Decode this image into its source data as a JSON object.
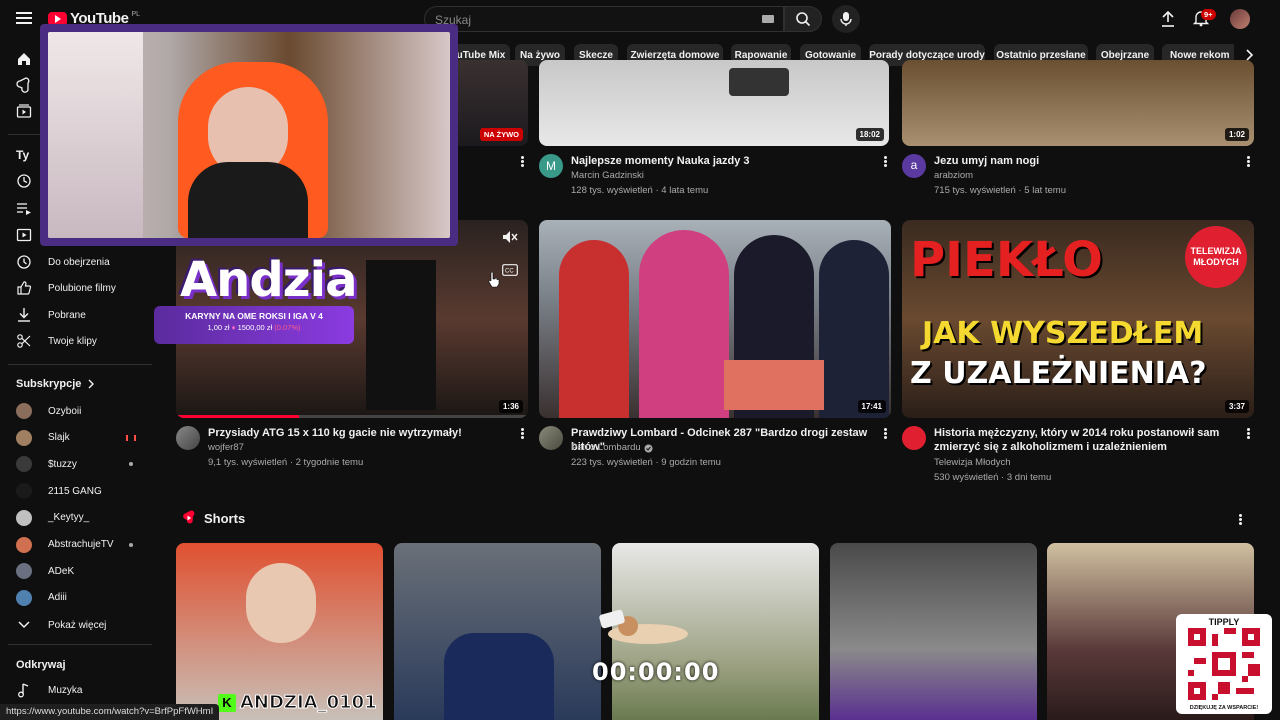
{
  "header": {
    "logo_text": "YouTube",
    "country_code": "PL",
    "search_placeholder": "Szukaj",
    "notification_count": "9+"
  },
  "sidebar": {
    "main_items": [
      {
        "icon": "home-icon"
      },
      {
        "icon": "shorts-icon"
      },
      {
        "icon": "subscriptions-icon"
      }
    ],
    "you_heading": "Ty",
    "you_items": [
      {
        "icon": "history-icon",
        "label": ""
      },
      {
        "icon": "playlists-icon",
        "label": ""
      },
      {
        "icon": "your-videos-icon",
        "label": ""
      },
      {
        "icon": "watch-later-icon",
        "label": "Do obejrzenia"
      },
      {
        "icon": "like-icon",
        "label": "Polubione filmy"
      },
      {
        "icon": "download-icon",
        "label": "Pobrane"
      },
      {
        "icon": "scissors-icon",
        "label": "Twoje klipy"
      }
    ],
    "subs_heading": "Subskrypcje",
    "channels": [
      {
        "name": "Ozyboii",
        "color": "#8a6d5a",
        "live": false,
        "dot": false
      },
      {
        "name": "Slajk",
        "color": "#a08060",
        "live": true,
        "dot": false
      },
      {
        "name": "$tuzzy",
        "color": "#3a3a3a",
        "live": false,
        "dot": true
      },
      {
        "name": "2115 GANG",
        "color": "#1a1a1a",
        "live": false,
        "dot": false
      },
      {
        "name": "_Keytyy_",
        "color": "#c0c0c0",
        "live": false,
        "dot": false
      },
      {
        "name": "AbstrachujeTV",
        "color": "#d07050",
        "live": false,
        "dot": true
      },
      {
        "name": "ADeK",
        "color": "#6a7080",
        "live": false,
        "dot": false
      },
      {
        "name": "Adiii",
        "color": "#5080b0",
        "live": false,
        "dot": false
      }
    ],
    "show_more": "Pokaż więcej",
    "explore_heading": "Odkrywaj",
    "explore_items": [
      {
        "icon": "music-icon",
        "label": "Muzyka"
      }
    ]
  },
  "chips": [
    "YouTube Mix",
    "Na żywo",
    "Skecze",
    "Zwierzęta domowe",
    "Rapowanie",
    "Gotowanie",
    "Porady dotyczące urody",
    "Ostatnio przesłane",
    "Obejrzane",
    "Nowe rekomendacje"
  ],
  "chip_visible_text": [
    "uTube Mix",
    "Na żywo",
    "Skecze",
    "Zwierzęta domowe",
    "Rapowanie",
    "Gotowanie",
    "Porady dotyczące urody",
    "Ostatnio przesłane",
    "Obejrzane",
    "Nowe rekom"
  ],
  "row1": [
    {
      "title": "",
      "channel": "",
      "meta": "",
      "badge": "NA ŻYWO"
    },
    {
      "title": "Najlepsze momenty Nauka jazdy 3",
      "channel": "Marcin Gadzinski",
      "meta": "128 tys. wyświetleń · 4 lata temu",
      "duration": "18:02",
      "avatar_letter": "M",
      "avatar_color": "#3a9a8a"
    },
    {
      "title": "Jezu umyj nam nogi",
      "channel": "arabziom",
      "meta": "715 tys. wyświetleń · 5 lat temu",
      "duration": "1:02",
      "avatar_letter": "a",
      "avatar_color": "#5a3aa0"
    }
  ],
  "row2": [
    {
      "title": "Przysiady ATG 15 x 110 kg gacie nie wytrzymały!",
      "channel": "wojfer87",
      "meta": "9,1 tys. wyświetleń · 2 tygodnie temu",
      "duration": "1:36",
      "progress": 0.35
    },
    {
      "title": "Prawdziwy Lombard - Odcinek 287 \"Bardzo drogi zestaw bitów\"",
      "channel": "Pan z Lombardu",
      "meta": "223 tys. wyświetleń · 9 godzin temu",
      "duration": "17:41"
    },
    {
      "title_line1": "Historia mężczyzny, który w 2014 roku postanowił sam",
      "title_line2": "zmierzyć się z alkoholizmem i uzależnieniem",
      "channel": "Telewizja Młodych",
      "meta": "530 wyświetleń · 3 dni temu",
      "duration": "3:37",
      "thumb_line1": "PIEKŁO",
      "thumb_line2": "JAK WYSZEDŁEM",
      "thumb_line3": "Z UZALEŻNIENIA?",
      "badge": "TELEWIZJA MŁODYCH"
    }
  ],
  "shorts_heading": "Shorts",
  "overlay": {
    "name": "Andzia",
    "goal_text": "KARYNY NA OME ROKSI I IGA V 4",
    "goal_current": "1,00 zł",
    "goal_target": "1500,00 zł",
    "goal_percent": "(0.07%)",
    "timer": "00:00:00",
    "kick_name": "ANDZIA_0101",
    "tipply_title": "TIPPLY",
    "tipply_thanks": "DZIĘKUJĘ ZA WSPARCIE!"
  },
  "status_url": "https://www.youtube.com/watch?v=BrfPpFfWHmI",
  "colors": {
    "accent": "#ff0033",
    "overlay_purple": "#4a2c82",
    "kick_green": "#53fc18"
  }
}
